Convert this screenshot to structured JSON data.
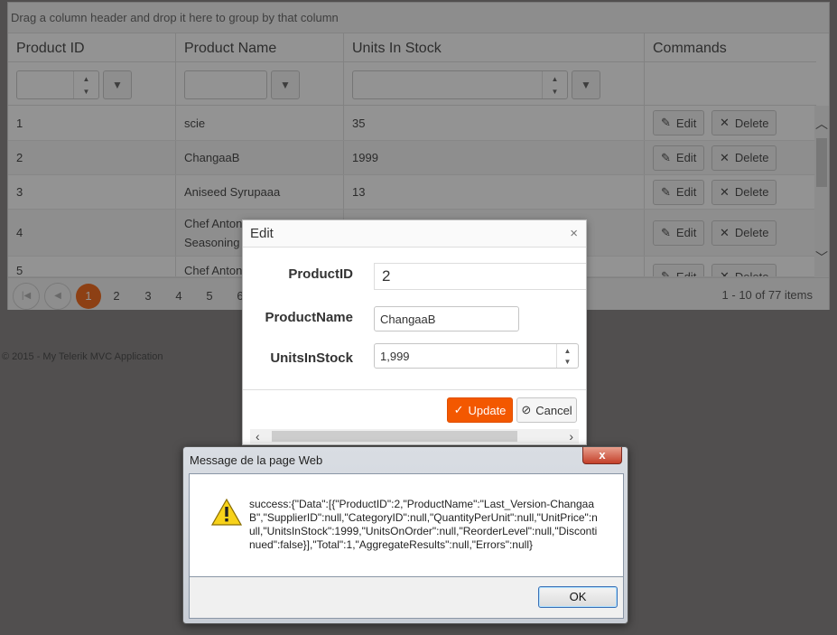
{
  "grid": {
    "group_hint": "Drag a column header and drop it here to group by that column",
    "columns": [
      "Product ID",
      "Product Name",
      "Units In Stock",
      "Commands"
    ],
    "rows": [
      {
        "id": "1",
        "name": "scie",
        "stock": "35"
      },
      {
        "id": "2",
        "name": "ChangaaB",
        "stock": "1999"
      },
      {
        "id": "3",
        "name": "Aniseed Syrupaaa",
        "stock": "13"
      },
      {
        "id": "4",
        "name": "Chef Anton",
        "name2": "Seasoning",
        "stock": ""
      },
      {
        "id": "5",
        "name": "Chef Anton",
        "stock": ""
      }
    ],
    "edit_label": "Edit",
    "delete_label": "Delete",
    "pages": [
      "1",
      "2",
      "3",
      "4",
      "5",
      "6"
    ],
    "active_page": "1",
    "pager_info": "1 - 10 of 77 items"
  },
  "footer": "© 2015 - My Telerik MVC Application",
  "edit_window": {
    "title": "Edit",
    "close_glyph": "×",
    "product_id_label": "ProductID",
    "product_id_value": "2",
    "product_name_label": "ProductName",
    "product_name_value": "ChangaaB",
    "units_label": "UnitsInStock",
    "units_value": "1,999",
    "update_label": "Update",
    "cancel_label": "Cancel"
  },
  "message_box": {
    "title": "Message de la page Web",
    "close_glyph": "x",
    "text": "success:{\"Data\":[{\"ProductID\":2,\"ProductName\":\"Last_Version-ChangaaB\",\"SupplierID\":null,\"CategoryID\":null,\"QuantityPerUnit\":null,\"UnitPrice\":null,\"UnitsInStock\":1999,\"UnitsOnOrder\":null,\"ReorderLevel\":null,\"Discontinued\":false}],\"Total\":1,\"AggregateResults\":null,\"Errors\":null}",
    "ok_label": "OK"
  },
  "colors": {
    "accent": "#f35800",
    "overlay": "#282828"
  }
}
